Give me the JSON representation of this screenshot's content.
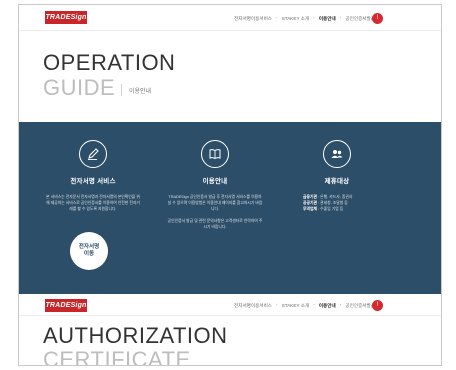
{
  "header": {
    "logo_text": "TRADESign",
    "nav": [
      "전자서명이용서비스",
      "STAKEY 소개",
      "이용안내",
      "공인인증서발급"
    ],
    "active_index": 2,
    "badge": "!"
  },
  "operation": {
    "title": "OPERATION",
    "subtitle": "GUIDE",
    "subtitle_kor": "이용안내"
  },
  "features": [
    {
      "icon": "pen-icon",
      "title": "전자서명 서비스",
      "text": "본 서비스는 전자문서 전자서명과 전자서명의 본인확인을 위해 제공하는 서비스로 공인인증서를 이용하여 안전한 전자거래를 할 수 있도록 지원합니다."
    },
    {
      "icon": "book-icon",
      "title": "이용안내",
      "text1": "TRADESign 공인인증서 발급 후 전자서명 서비스를 이용하실 수 있으며 이용방법은 이용안내 페이지를 참고하시기 바랍니다.",
      "text2": "공인인증서 발급 및 관련 문의사항은 고객센터로 연락하여 주시기 바랍니다."
    },
    {
      "icon": "users-icon",
      "title": "제휴대상",
      "lines": [
        {
          "label": "금융기관",
          "value": "은행, 카드사, 증권사"
        },
        {
          "label": "공공기관",
          "value": "관세청, 조달청 등"
        },
        {
          "label": "무역업체",
          "value": "수출입 기업 등"
        }
      ]
    }
  ],
  "cta": {
    "line1": "전자서명",
    "line2": "이동"
  },
  "authorization": {
    "title": "AUTHORIZATION",
    "subtitle": "CERTIFICATE"
  },
  "colors": {
    "accent": "#c8262b",
    "section_bg": "#2d4e68"
  }
}
